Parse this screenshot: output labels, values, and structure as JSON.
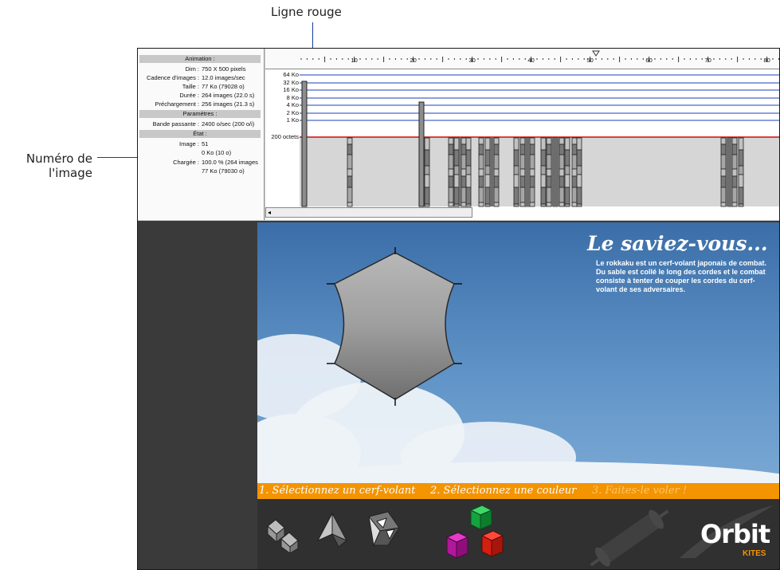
{
  "callouts": {
    "top": "Ligne rouge",
    "side_line1": "Numéro de",
    "side_line2": "l'image"
  },
  "stats": {
    "animation_header": "Animation :",
    "rows_a": [
      {
        "key": "Dim :",
        "value": "750 X 500 pixels"
      },
      {
        "key": "Cadence d'images :",
        "value": "12.0 images/sec"
      },
      {
        "key": "Taille :",
        "value": "77 Ko (79028 o)"
      },
      {
        "key": "Durée :",
        "value": "264 images (22.0 s)"
      },
      {
        "key": "Préchargement :",
        "value": "256 images (21.3 s)"
      }
    ],
    "params_header": "Paramètres :",
    "bandwidth_key": "Bande passante :",
    "bandwidth_value": "2400 o/sec (200 o/i)",
    "state_header": "État :",
    "image_key": "Image :",
    "image_value": "51",
    "image_size": "0 Ko (10 o)",
    "loaded_key": "Chargée :",
    "loaded_value": "100.0 % (264 images",
    "loaded_size": "77 Ko (79030 o)"
  },
  "graph": {
    "ruler_labels": [
      "10",
      "20",
      "30",
      "40",
      "50",
      "60",
      "70",
      "80"
    ],
    "current_frame": 51,
    "size_labels": [
      "64 Ko",
      "32 Ko",
      "16 Ko",
      "8 Ko",
      "4 Ko",
      "2 Ko",
      "1 Ko",
      "200 octets"
    ],
    "red_line_color": "#cc0000",
    "line_color": "#1e3fbf"
  },
  "scroll": {
    "arrow": "◂"
  },
  "stage": {
    "title": "Le saviez-vous...",
    "fact": "Le rokkaku est un cerf-volant japonais de combat. Du sable est collé le long des cordes et le combat consiste à tenter de couper les cordes du cerf-volant de ses adversaires.",
    "steps": [
      "1. Sélectionnez un cerf-volant",
      "2. Sélectionnez une couleur",
      "3. Faites-le voler !"
    ],
    "banner_color": "#f39400",
    "logo": "Orbit",
    "logo_sub": "KITES",
    "tool_icons": [
      "box-kite-icon",
      "delta-kite-icon",
      "tetrahedral-kite-icon",
      "color-cubes-icon",
      "kite-spool-icon"
    ]
  }
}
